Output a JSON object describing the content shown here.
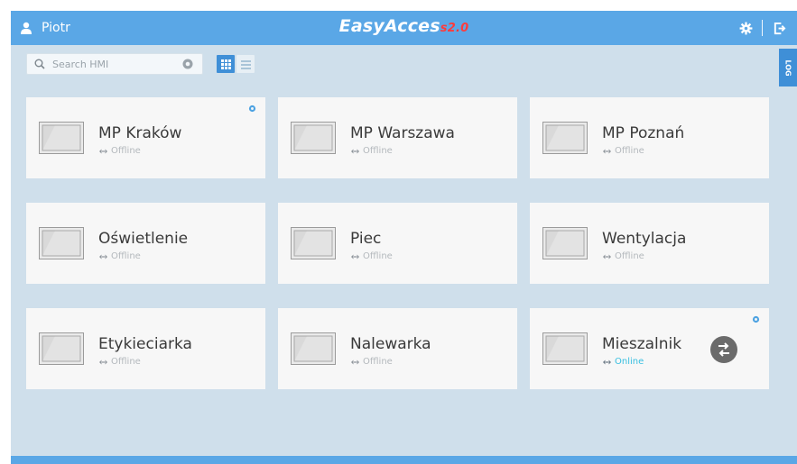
{
  "header": {
    "user_name": "Piotr",
    "brand_name": "EasyAcces",
    "brand_version": "s2.0",
    "brand_accent_color": "#ff3b3b",
    "bar_color": "#5aa7e6"
  },
  "search": {
    "placeholder": "Search HMI",
    "value": ""
  },
  "view": {
    "selected": "grid",
    "options": [
      "grid",
      "list"
    ]
  },
  "log_tab": {
    "label": "LOG"
  },
  "devices": [
    {
      "name": "MP Kraków",
      "status": "Offline",
      "online": false,
      "has_settings": true
    },
    {
      "name": "MP Warszawa",
      "status": "Offline",
      "online": false,
      "has_settings": false
    },
    {
      "name": "MP Poznań",
      "status": "Offline",
      "online": false,
      "has_settings": false
    },
    {
      "name": "Oświetlenie",
      "status": "Offline",
      "online": false,
      "has_settings": false
    },
    {
      "name": "Piec",
      "status": "Offline",
      "online": false,
      "has_settings": false
    },
    {
      "name": "Wentylacja",
      "status": "Offline",
      "online": false,
      "has_settings": false
    },
    {
      "name": "Etykieciarka",
      "status": "Offline",
      "online": false,
      "has_settings": false
    },
    {
      "name": "Nalewarka",
      "status": "Offline",
      "online": false,
      "has_settings": false
    },
    {
      "name": "Mieszalnik",
      "status": "Online",
      "online": true,
      "has_settings": true,
      "has_connect": true
    }
  ],
  "icons": {
    "user": "user-icon",
    "settings": "gear-icon",
    "logout": "logout-icon",
    "search": "search-icon",
    "clear": "clear-icon",
    "grid_view": "grid-view-icon",
    "list_view": "list-view-icon",
    "hmi": "hmi-screen-icon",
    "status": "link-icon",
    "connect": "connect-icon"
  }
}
